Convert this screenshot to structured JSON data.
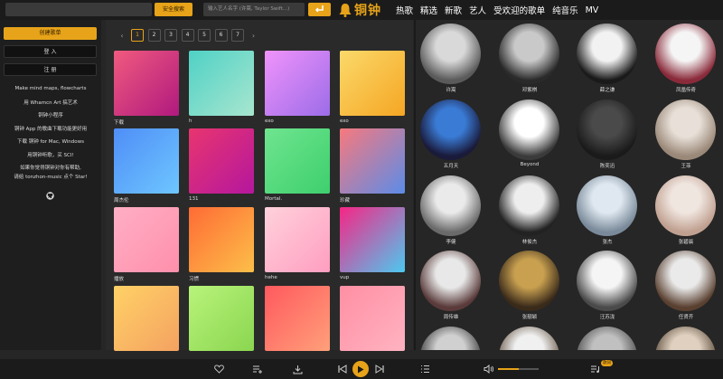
{
  "topbar": {
    "safe_search_label": "安全搜索",
    "artist_search_placeholder": "输入艺人名字 (许嵩, Taylor Swift...)",
    "logo_text": "铜钟",
    "nav": [
      "热歌",
      "精选",
      "新歌",
      "艺人",
      "受欢迎的歌单",
      "纯音乐",
      "MV"
    ]
  },
  "sidebar": {
    "create_label": "创建歌单",
    "login_label": "登 入",
    "register_label": "注 册",
    "links": [
      "Make mind maps, flowcharts",
      "用 Whamcn Art 搞艺术",
      "铜钟小程序",
      "铜钟 App 的歌曲下载功能更好用",
      "下载 铜钟 for Mac, Windows",
      "用铜钟听歌，买 SCI!",
      "如果你觉得铜钟对你有帮助,",
      "请给 tonzhon-music 点个 Star!"
    ],
    "github_icon": "github-icon"
  },
  "pager": {
    "pages": [
      "1",
      "2",
      "3",
      "4",
      "5",
      "6",
      "7"
    ],
    "active": "1",
    "prev_symbol": "‹",
    "next_symbol": "›"
  },
  "playlists": [
    {
      "label": "下载",
      "colors": [
        "#f05a7e",
        "#b0197e"
      ]
    },
    {
      "label": "h",
      "colors": [
        "#4fd1c5",
        "#a8e6cf"
      ]
    },
    {
      "label": "exo",
      "colors": [
        "#f093fb",
        "#9c6ce8"
      ]
    },
    {
      "label": "exo",
      "colors": [
        "#fbd96a",
        "#f5a623"
      ]
    },
    {
      "label": "周杰伦",
      "colors": [
        "#4f8ef7",
        "#6ec6ff"
      ]
    },
    {
      "label": "131",
      "colors": [
        "#e8356f",
        "#b5179e"
      ]
    },
    {
      "label": "Mortal.",
      "colors": [
        "#6fe58f",
        "#3ecf6e"
      ]
    },
    {
      "label": "珍藏",
      "colors": [
        "#f7797d",
        "#5b8ce8"
      ]
    },
    {
      "label": "播放",
      "colors": [
        "#ffafc5",
        "#ff8fab"
      ]
    },
    {
      "label": "习惯",
      "colors": [
        "#ff6b35",
        "#fcbf49"
      ]
    },
    {
      "label": "hehe",
      "colors": [
        "#ffd1dc",
        "#ff9ec0"
      ]
    },
    {
      "label": "vup",
      "colors": [
        "#f72585",
        "#4cc9f0"
      ]
    },
    {
      "label": "",
      "colors": [
        "#ffd166",
        "#f4a261"
      ]
    },
    {
      "label": "",
      "colors": [
        "#b8f37a",
        "#8bd650"
      ]
    },
    {
      "label": "",
      "colors": [
        "#ff595e",
        "#ffa07a"
      ]
    },
    {
      "label": "",
      "colors": [
        "#ff8fa3",
        "#ffb3c1"
      ]
    }
  ],
  "artists": [
    {
      "name": "许嵩",
      "colors": [
        "#d9d9d9",
        "#5a5a5a"
      ]
    },
    {
      "name": "邓紫棋",
      "colors": [
        "#c9c9c9",
        "#2a2a2a"
      ]
    },
    {
      "name": "薛之谦",
      "colors": [
        "#f2f2f2",
        "#1a1a1a"
      ]
    },
    {
      "name": "凤凰传奇",
      "colors": [
        "#f5f5f5",
        "#8a2a3a"
      ]
    },
    {
      "name": "五月天",
      "colors": [
        "#3a7bd5",
        "#1a1a3a"
      ]
    },
    {
      "name": "Beyond",
      "colors": [
        "#ffffff",
        "#3a3a3a"
      ]
    },
    {
      "name": "陈奕迅",
      "colors": [
        "#4a4a4a",
        "#1a1a1a"
      ]
    },
    {
      "name": "王菲",
      "colors": [
        "#e8e0d8",
        "#9a8878"
      ]
    },
    {
      "name": "李健",
      "colors": [
        "#eaeaea",
        "#6a6a6a"
      ]
    },
    {
      "name": "林俊杰",
      "colors": [
        "#eeeeee",
        "#222222"
      ]
    },
    {
      "name": "张杰",
      "colors": [
        "#dfe8f0",
        "#7a8a9a"
      ]
    },
    {
      "name": "张碧晨",
      "colors": [
        "#f0e6e0",
        "#c0a090"
      ]
    },
    {
      "name": "周传雄",
      "colors": [
        "#e8e8e8",
        "#5a3a3a"
      ]
    },
    {
      "name": "张靓颖",
      "colors": [
        "#c8a050",
        "#3a2a1a"
      ]
    },
    {
      "name": "汪苏泷",
      "colors": [
        "#f5f5f5",
        "#4a4a4a"
      ]
    },
    {
      "name": "任贤齐",
      "colors": [
        "#eaeaea",
        "#5a4030"
      ]
    },
    {
      "name": "",
      "colors": [
        "#d0d0d0",
        "#3a3a3a"
      ]
    },
    {
      "name": "",
      "colors": [
        "#f0f0f0",
        "#6a5a4a"
      ]
    },
    {
      "name": "",
      "colors": [
        "#c0c0c0",
        "#4a4a4a"
      ]
    },
    {
      "name": "",
      "colors": [
        "#e0d0c0",
        "#5a4a3a"
      ]
    }
  ],
  "player": {
    "icons": [
      "heart-icon",
      "playlist-add-icon",
      "download-icon",
      "previous-icon",
      "play-icon",
      "next-icon",
      "queue-icon",
      "volume-icon",
      "lyrics-icon"
    ],
    "volume": 0.5,
    "badge": "歌词"
  },
  "accent": "#e7a319"
}
